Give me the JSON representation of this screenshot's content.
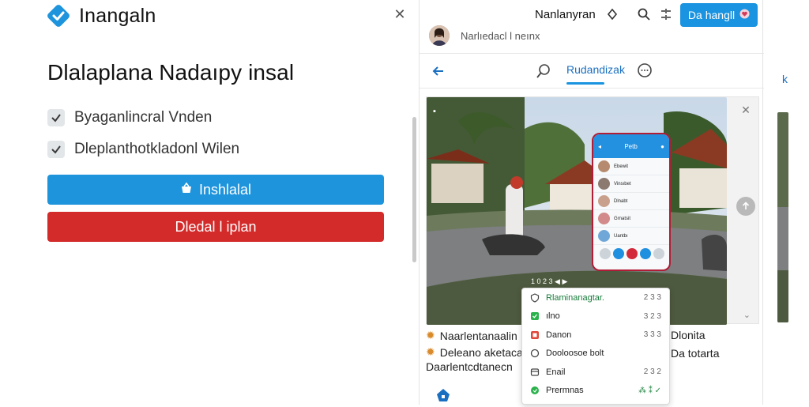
{
  "left": {
    "app_title": "Inangaln",
    "close_icon": "close-icon",
    "heading": "Dlalaplana Nadaıpy insal",
    "checklist": [
      {
        "label": "Byaganlincral Vnden",
        "checked": true
      },
      {
        "label": "Dleplanthotkladonl Wilen",
        "checked": true
      }
    ],
    "primary_button": "Inshlalal",
    "danger_button": "Dledal l iplan"
  },
  "window": {
    "user_name": "Nanlanyran",
    "share_button": "Da hangll",
    "subtitle": "Narlıedacl l neınx",
    "nav_tab": "Rudandizak",
    "card": {
      "caption": "1 0 2 3  ◀ ▶",
      "phone": {
        "header": "Petb",
        "items": [
          "Ebewit",
          "Vinsıbet",
          "Dlnabt",
          "Grnatsit",
          "Uantbı"
        ]
      }
    },
    "feed": [
      {
        "text": "Naarlentanaalin",
        "icon": "star-icon"
      },
      {
        "text": "Deleano aketacan",
        "icon": "star-icon"
      },
      {
        "text": "Daarlentcdtanecn",
        "icon": ""
      }
    ],
    "side_texts": [
      "Dlonita",
      "Da totarta"
    ]
  },
  "menu": {
    "items": [
      {
        "label": "Rlaminanagtar.",
        "value": "2 3 3",
        "icon": "shield-icon"
      },
      {
        "label": "ılno",
        "value": "3 2 3",
        "icon": "green-square-icon"
      },
      {
        "label": "Danon",
        "value": "3 3 3",
        "icon": "red-square-icon"
      },
      {
        "label": "Dooloosoe bolt",
        "value": "",
        "icon": "circle-icon"
      },
      {
        "label": "Enail",
        "value": "2 3 2",
        "icon": "box-icon"
      },
      {
        "label": "Prermnas",
        "value": "⁂ ⁑ ✓",
        "icon": "green-circle-icon"
      }
    ]
  },
  "strip": {
    "label": "k"
  },
  "colors": {
    "primary": "#1e94dc",
    "danger": "#d32a2a",
    "accent_link": "#1a6fc0"
  }
}
